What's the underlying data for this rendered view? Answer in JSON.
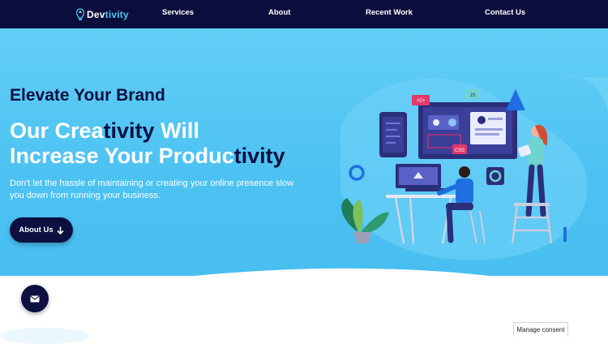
{
  "brand": {
    "name_part1": "Dev",
    "name_part2": "tivity"
  },
  "nav": {
    "services": "Services",
    "about": "About",
    "recent_work": "Recent Work",
    "contact_us": "Contact Us"
  },
  "hero": {
    "tagline": "Elevate Your Brand",
    "headline_line1_a": "Our Crea",
    "headline_line1_b": "tivity",
    "headline_line1_c": " Will",
    "headline_line2_a": "Increase Your Produc",
    "headline_line2_b": "tivity",
    "description": "Don't let the hassle of maintaining or creating your online presence slow you down from running your business.",
    "cta_label": "About Us"
  },
  "illustration": {
    "code_tag": "</>",
    "js_tag": "JS",
    "css_tag": "CSS"
  },
  "consent": {
    "label": "Manage consent"
  },
  "colors": {
    "navy": "#0c1040",
    "sky": "#4cc2f2",
    "accent": "#4cc6f1"
  },
  "icons": [
    "logo-icon",
    "arrow-down-icon",
    "mail-icon"
  ]
}
